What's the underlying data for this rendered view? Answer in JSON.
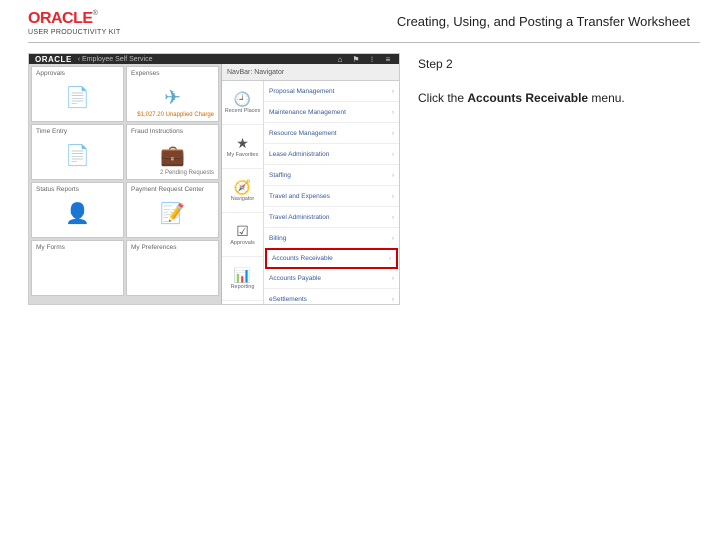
{
  "header": {
    "logo_name": "ORACLE",
    "logo_tm": "®",
    "logo_sub": "USER PRODUCTIVITY KIT",
    "title": "Creating, Using, and Posting a Transfer Worksheet"
  },
  "instruction": {
    "step": "Step 2",
    "pre": "Click the ",
    "bold": "Accounts Receivable",
    "post": " menu."
  },
  "shot": {
    "brand": "ORACLE",
    "breadcrumb": "‹ Employee Self Service",
    "icons": [
      "⌂",
      "⚑",
      "⁝",
      "≡"
    ],
    "tiles": [
      {
        "label": "Approvals",
        "icon": "📄",
        "icon_color": "#5aa9c9",
        "foot": ""
      },
      {
        "label": "Expenses",
        "icon": "✈",
        "icon_color": "#5aa9c9",
        "foot": "$1,027.20 Unapplied Charge",
        "orange": true
      },
      {
        "label": "Time Entry",
        "icon": "📄",
        "icon_color": "#b8b8b8",
        "foot": ""
      },
      {
        "label": "Fraud Instructions",
        "icon": "💼",
        "icon_color": "#b03a2e",
        "foot": "2 Pending Requests"
      },
      {
        "label": "Status Reports",
        "icon": "👤",
        "icon_color": "#b8b8b8",
        "foot": ""
      },
      {
        "label": "Payment Request Center",
        "icon": "📝",
        "icon_color": "#b8b8b8",
        "foot": ""
      },
      {
        "label": "My Forms",
        "icon": "",
        "icon_color": "",
        "foot": ""
      },
      {
        "label": "My Preferences",
        "icon": "",
        "icon_color": "",
        "foot": ""
      }
    ],
    "navhead": "NavBar: Navigator",
    "nav_icons": [
      {
        "glyph": "🕘",
        "cap": "Recent Places"
      },
      {
        "glyph": "★",
        "cap": "My Favorites"
      },
      {
        "glyph": "🧭",
        "cap": "Navigator"
      },
      {
        "glyph": "☑",
        "cap": "Approvals"
      },
      {
        "glyph": "📊",
        "cap": "Reporting"
      }
    ],
    "nav_items": [
      {
        "label": "Proposal Management",
        "hl": false
      },
      {
        "label": "Maintenance Management",
        "hl": false
      },
      {
        "label": "Resource Management",
        "hl": false
      },
      {
        "label": "Lease Administration",
        "hl": false
      },
      {
        "label": "Staffing",
        "hl": false
      },
      {
        "label": "Travel and Expenses",
        "hl": false
      },
      {
        "label": "Travel Administration",
        "hl": false
      },
      {
        "label": "Billing",
        "hl": false
      },
      {
        "label": "Accounts Receivable",
        "hl": true
      },
      {
        "label": "Accounts Payable",
        "hl": false
      },
      {
        "label": "eSettlements",
        "hl": false
      }
    ]
  }
}
